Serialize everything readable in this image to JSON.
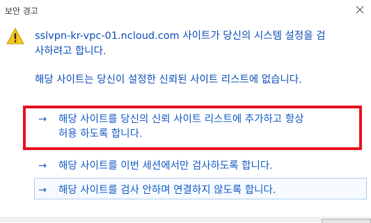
{
  "window": {
    "title": "보안 경고",
    "close_glyph": "✕"
  },
  "message": {
    "line1": "sslvpn-kr-vpc-01.ncloud.com 사이트가 당신의 시스템 설정을 검",
    "line2": "사하려고 합니다.",
    "subtext": "해당 사이트는 당신이 설정한 신뢰된 사이트 리스트에 없습니다."
  },
  "options": [
    {
      "arrow": "→",
      "line1": "해당 사이트를 당신의 신뢰 사이트 리스트에 추가하고 항상",
      "line2": "허용 하도록 합니다."
    },
    {
      "arrow": "→",
      "text": "해당 사이트를 이번 세션에서만 검사하도록 합니다."
    },
    {
      "arrow": "→",
      "text": "해당 사이트를 검사 안하며 연결하지 않도록 합니다."
    }
  ],
  "icons": {
    "warning": "warning-icon",
    "close": "close-icon",
    "arrow": "arrow-right-icon"
  },
  "colors": {
    "text_blue": "#0a4bb8",
    "link_blue": "#1059c6",
    "highlight_red": "#e8101c",
    "warning_yellow": "#f5c518"
  }
}
